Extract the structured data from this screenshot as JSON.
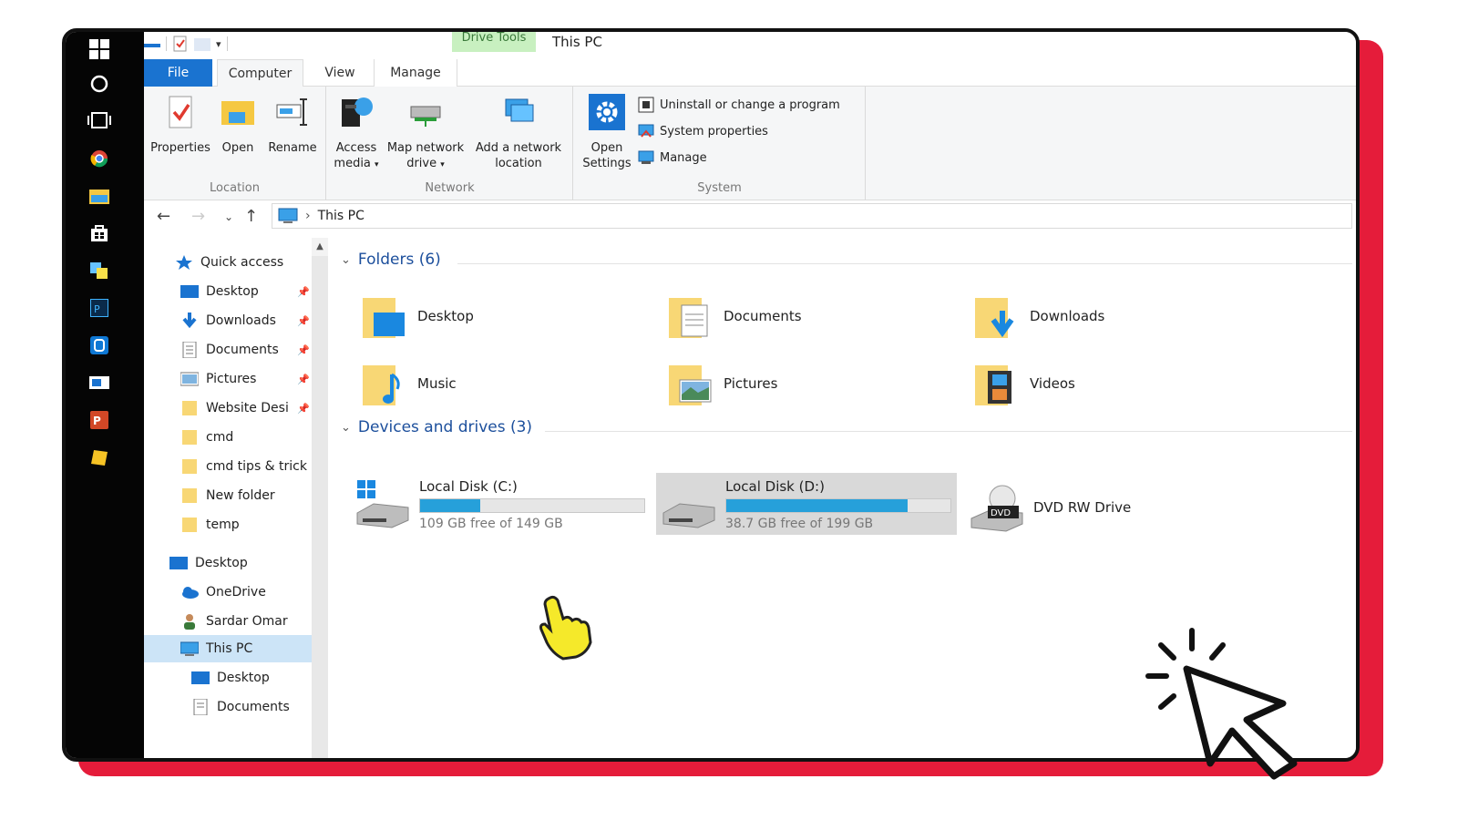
{
  "window": {
    "title": "This PC",
    "context_tab": "Drive Tools"
  },
  "tabs": {
    "file": "File",
    "computer": "Computer",
    "view": "View",
    "manage": "Manage"
  },
  "ribbon": {
    "location": {
      "label": "Location",
      "properties": "Properties",
      "open": "Open",
      "rename": "Rename"
    },
    "network": {
      "label": "Network",
      "access_media_1": "Access",
      "access_media_2": "media",
      "map_drive_1": "Map network",
      "map_drive_2": "drive",
      "add_location_1": "Add a network",
      "add_location_2": "location"
    },
    "system": {
      "label": "System",
      "open_settings_1": "Open",
      "open_settings_2": "Settings",
      "uninstall": "Uninstall or change a program",
      "system_properties": "System properties",
      "manage": "Manage"
    }
  },
  "address": {
    "path": "This PC"
  },
  "nav": {
    "quick_access": "Quick access",
    "items": [
      {
        "label": "Desktop"
      },
      {
        "label": "Downloads"
      },
      {
        "label": "Documents"
      },
      {
        "label": "Pictures"
      },
      {
        "label": "Website Desi"
      },
      {
        "label": "cmd"
      },
      {
        "label": "cmd tips & trick"
      },
      {
        "label": "New folder"
      },
      {
        "label": "temp"
      }
    ],
    "desktop_root": "Desktop",
    "onedrive": "OneDrive",
    "user": "Sardar Omar",
    "this_pc": "This PC",
    "pc_children": [
      {
        "label": "Desktop"
      },
      {
        "label": "Documents"
      }
    ]
  },
  "folders": {
    "heading": "Folders (6)",
    "items": [
      {
        "label": "Desktop"
      },
      {
        "label": "Documents"
      },
      {
        "label": "Downloads"
      },
      {
        "label": "Music"
      },
      {
        "label": "Pictures"
      },
      {
        "label": "Videos"
      }
    ]
  },
  "drives": {
    "heading": "Devices and drives (3)",
    "items": [
      {
        "label": "Local Disk (C:)",
        "free": "109 GB free of 149 GB",
        "used_fraction": 0.27
      },
      {
        "label": "Local Disk (D:)",
        "free": "38.7 GB free of 199 GB",
        "used_fraction": 0.81
      },
      {
        "label": "DVD RW Drive"
      }
    ],
    "dvd_badge": "DVD"
  },
  "colors": {
    "accent": "#1a73d0",
    "frame_shadow": "#e51c3a",
    "selected": "#cce4f7",
    "bar_fill": "#26a0da",
    "folder": "#f5c842"
  }
}
